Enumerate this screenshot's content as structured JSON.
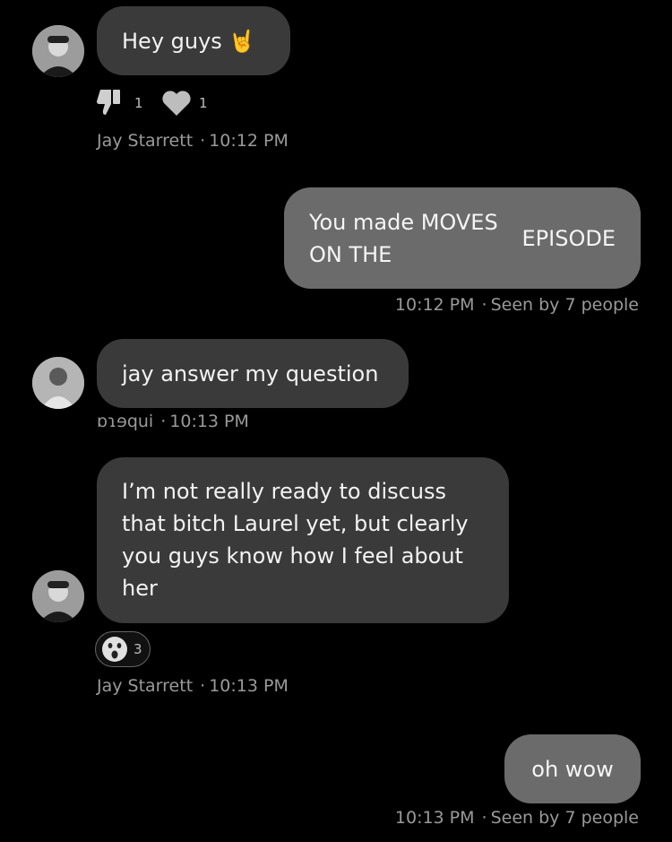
{
  "messages": [
    {
      "sender": "Jay Starrett",
      "text": "Hey guys 🤘",
      "time": "10:12 PM",
      "reactions": [
        {
          "icon": "thumbs-down",
          "count": "1"
        },
        {
          "icon": "heart",
          "count": "1"
        }
      ]
    },
    {
      "text": "You made MOVES ON THE EPISODE",
      "line1": "You made MOVES ON THE",
      "line2": "EPISODE",
      "time": "10:12 PM",
      "seen": "Seen by 7 people"
    },
    {
      "sender": "ɒɿɘqui",
      "text": "jay answer my question",
      "time": "10:13 PM"
    },
    {
      "sender": "Jay Starrett",
      "lines": [
        "I’m not really ready to discuss",
        "that bitch Laurel yet, but clearly",
        "you guys know how I feel about",
        "her"
      ],
      "time": "10:13 PM",
      "reactions": [
        {
          "icon": "surprised-face",
          "count": "3"
        }
      ]
    },
    {
      "text": "oh wow",
      "time": "10:13 PM",
      "seen": "Seen by 7 people"
    }
  ],
  "colors": {
    "background": "#000000",
    "incoming_bubble": "#3a3a3a",
    "outgoing_bubble": "#6b6b6b",
    "meta_text": "#9a9a9a"
  }
}
